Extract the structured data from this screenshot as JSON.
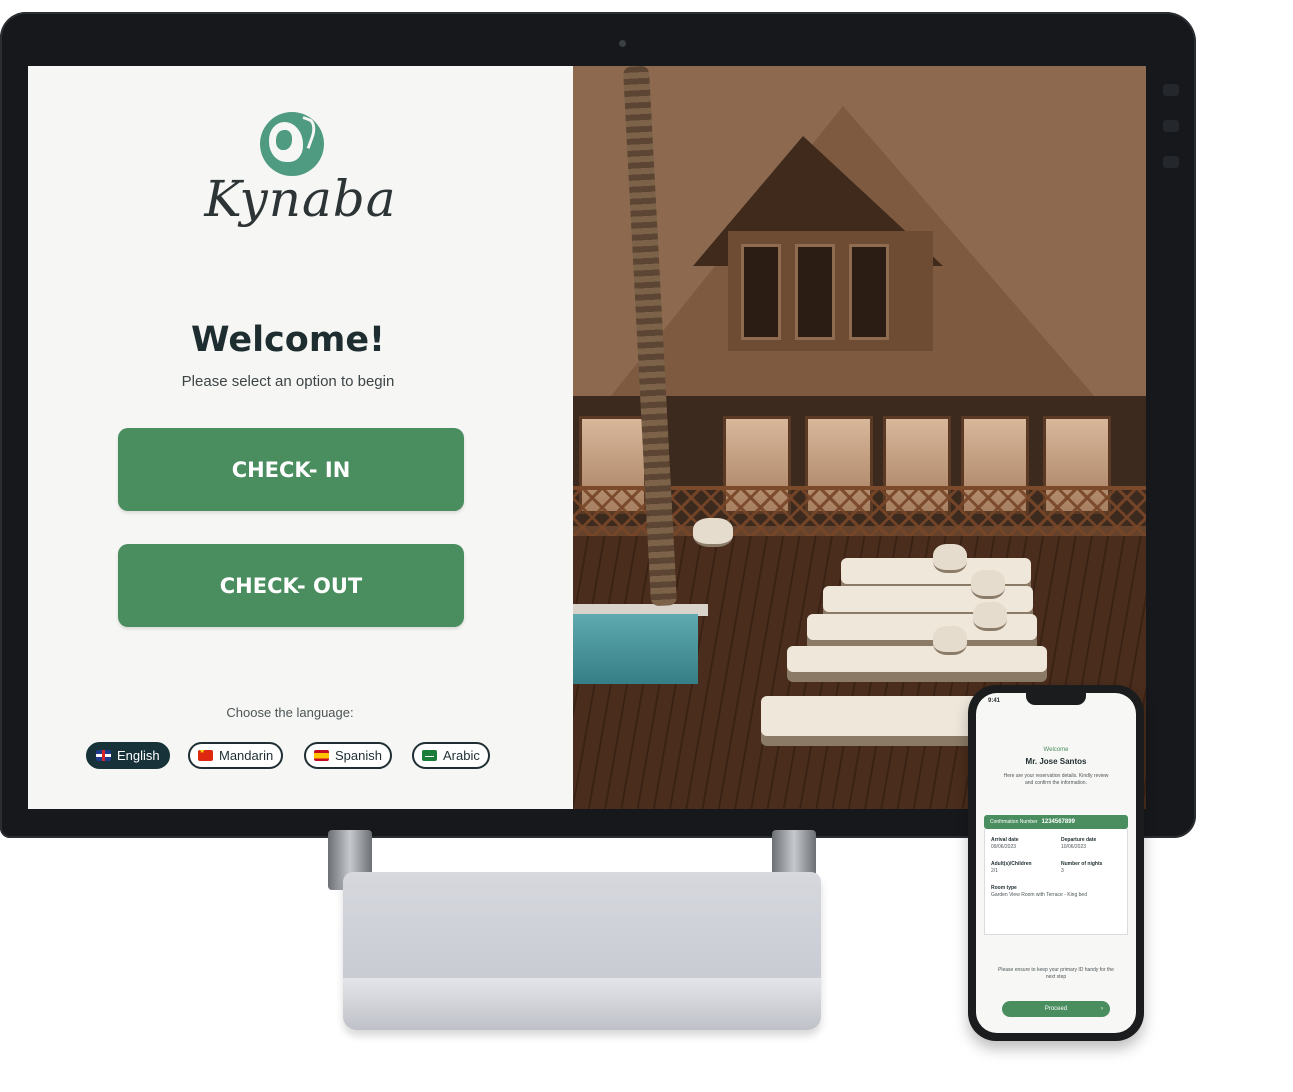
{
  "kiosk": {
    "brand_name": "Kynaba",
    "welcome_title": "Welcome!",
    "welcome_subtitle": "Please select an option to begin",
    "checkin_label": "CHECK- IN",
    "checkout_label": "CHECK- OUT",
    "language_prompt": "Choose the language:",
    "languages": [
      {
        "label": "English",
        "flag": "uk-flag-icon",
        "active": true
      },
      {
        "label": "Mandarin",
        "flag": "china-flag-icon",
        "active": false
      },
      {
        "label": "Spanish",
        "flag": "spain-flag-icon",
        "active": false
      },
      {
        "label": "Arabic",
        "flag": "saudi-flag-icon",
        "active": false
      }
    ]
  },
  "phone": {
    "time": "9:41",
    "welcome": "Welcome",
    "guest_name": "Mr. Jose Santos",
    "description": "Here are your reservation details. Kindly review and confirm the information.",
    "confirmation_label": "Confirmation Number",
    "confirmation_number": "1234567899",
    "fields": {
      "arrival": {
        "label": "Arrival date",
        "value": "09/06/2023"
      },
      "departure": {
        "label": "Departure date",
        "value": "10/06/2023"
      },
      "guests": {
        "label": "Adult(s)/Children",
        "value": "2/1"
      },
      "nights": {
        "label": "Number of nights",
        "value": "3"
      },
      "room": {
        "label": "Room type",
        "value": "Garden View Room with Terrace - King bed"
      }
    },
    "note": "Please ensure to keep your primary ID handy for the next step",
    "proceed_label": "Proceed"
  },
  "colors": {
    "accent_green": "#4a8d5f",
    "logo_teal": "#4f9b82",
    "dark_text": "#1e2d2f",
    "active_pill": "#173238"
  }
}
